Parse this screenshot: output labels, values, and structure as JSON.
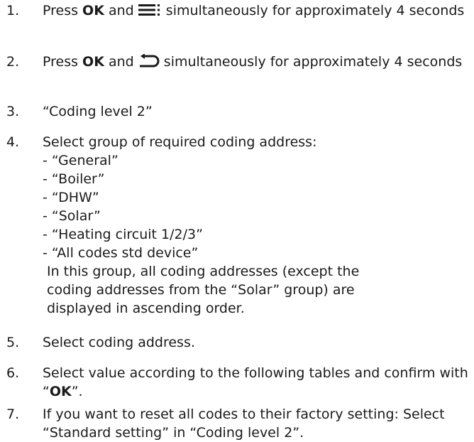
{
  "steps": [
    {
      "num": "1.",
      "prefix": "Press ",
      "bold": "OK",
      "mid": " and ",
      "icon": "menu-icon",
      "suffix": " simultaneously for approximately 4 seconds"
    },
    {
      "num": "2.",
      "prefix": "Press ",
      "bold": "OK",
      "mid": " and ",
      "icon": "back-arrow-icon",
      "suffix": " simultaneously for approximately 4 seconds"
    },
    {
      "num": "3.",
      "text": "“Coding level 2”"
    },
    {
      "num": "4.",
      "text": "Select group of required coding address:",
      "items": [
        "- “General”",
        "- “Boiler”",
        "- “DHW”",
        "- “Solar”",
        "- “Heating circuit 1/2/3”",
        "- “All codes std device”"
      ],
      "note": "In this group, all coding addresses (except the coding addresses from the “Solar” group) are displayed in ascending order."
    },
    {
      "num": "5.",
      "text": "Select coding address."
    },
    {
      "num": "6.",
      "text": "Select value according to the following tables and confirm with “",
      "bold": "OK",
      "suffix": "”."
    },
    {
      "num": "7.",
      "text": "If you want to reset all codes to their factory setting: Select “Standard setting” in “Coding level 2”."
    }
  ]
}
